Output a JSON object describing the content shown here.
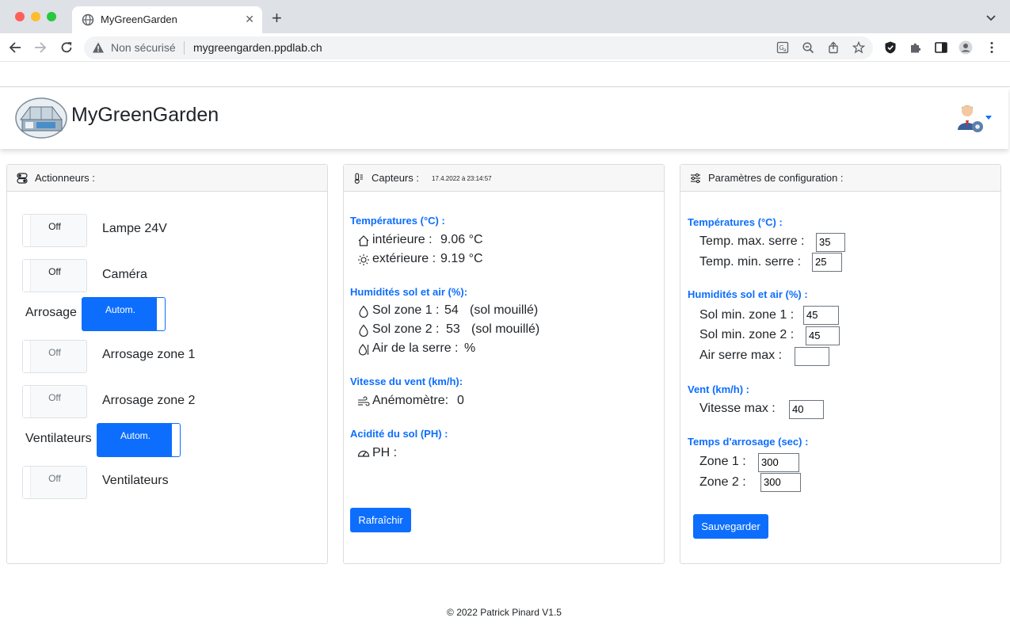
{
  "browser": {
    "tab_title": "MyGreenGarden",
    "address_security": "Non sécurisé",
    "address_url": "mygreengarden.ppdlab.ch"
  },
  "navbar": {
    "brand": "MyGreenGarden"
  },
  "actuators": {
    "title": "Actionneurs :",
    "items": [
      {
        "state": "Off",
        "label": "Lampe 24V"
      },
      {
        "state": "Off",
        "label": "Caméra"
      },
      {
        "mode_label": "Arrosage",
        "state": "Autom."
      },
      {
        "state": "Off",
        "label": "Arrosage zone 1"
      },
      {
        "state": "Off",
        "label": "Arrosage zone 2"
      },
      {
        "mode_label": "Ventilateurs",
        "state": "Autom."
      },
      {
        "state": "Off",
        "label": "Ventilateurs"
      }
    ]
  },
  "sensors": {
    "title": "Capteurs :",
    "timestamp": "17.4.2022 à 23:14:57",
    "temperature": {
      "title": "Températures (°C) :",
      "inside_label": "intérieure :",
      "inside_value": "9.06 °C",
      "outside_label": "extérieure :",
      "outside_value": "9.19 °C"
    },
    "humidity": {
      "title": "Humidités sol et air (%):",
      "zone1_label": "Sol zone 1 :",
      "zone1_value": "54",
      "zone1_status": "(sol mouillé)",
      "zone2_label": "Sol zone 2 :",
      "zone2_value": "53",
      "zone2_status": "(sol mouillé)",
      "air_label": "Air de la serre :",
      "air_unit": "%"
    },
    "wind": {
      "title": "Vitesse du vent (km/h):",
      "label": "Anémomètre:",
      "value": "0"
    },
    "ph": {
      "title": "Acidité du sol (PH) :",
      "label": "PH :"
    },
    "refresh_button": "Rafraîchir"
  },
  "config": {
    "title": "Paramètres de configuration :",
    "temperature": {
      "title": "Températures (°C) :",
      "max_label": "Temp. max. serre :",
      "max_value": "35",
      "min_label": "Temp. min. serre :",
      "min_value": "25"
    },
    "humidity": {
      "title": "Humidités sol et air (%) :",
      "zone1_label": "Sol min. zone 1 :",
      "zone1_value": "45",
      "zone2_label": "Sol min. zone 2 :",
      "zone2_value": "45",
      "air_label": "Air serre max :",
      "air_value": ""
    },
    "wind": {
      "title": "Vent (km/h) :",
      "label": "Vitesse max :",
      "value": "40"
    },
    "watering": {
      "title": "Temps d'arrosage (sec) :",
      "zone1_label": "Zone 1 :",
      "zone1_value": "300",
      "zone2_label": "Zone 2 :",
      "zone2_value": "300"
    },
    "save_button": "Sauvegarder"
  },
  "footer": {
    "text": "© 2022 Patrick Pinard V1.5"
  },
  "colors": {
    "accent": "#0d6efd",
    "section_title": "#0d6efd"
  }
}
